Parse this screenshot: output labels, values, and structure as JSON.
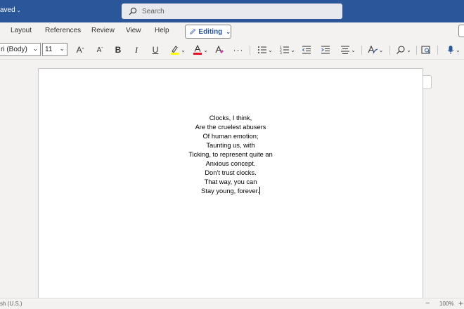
{
  "titlebar": {
    "doc_status": "aved",
    "search_placeholder": "Search"
  },
  "ribbon_tabs": [
    "Layout",
    "References",
    "Review",
    "View",
    "Help"
  ],
  "editing_mode": "Editing",
  "toolbar": {
    "font_name": "ri (Body)",
    "font_size": "11",
    "grow_font": "A",
    "shrink_font": "A",
    "bold": "B",
    "italic": "I",
    "underline": "U",
    "more": "···",
    "colors": {
      "highlight": "#ffff00",
      "font_color": "#e81123",
      "accent": "#2b579a"
    },
    "icons": [
      "grow-font-icon",
      "shrink-font-icon",
      "highlight-icon",
      "font-color-icon",
      "clear-format-icon",
      "bullets-icon",
      "numbering-icon",
      "decrease-indent-icon",
      "increase-indent-icon",
      "align-icon",
      "styles-icon",
      "find-icon",
      "reuse-files-icon",
      "dictate-icon"
    ]
  },
  "document": {
    "poem_lines": [
      "Clocks, I think,",
      "Are the cruelest abusers",
      "Of human emotion;",
      "Taunting us, with",
      "Ticking, to represent quite an",
      "Anxious concept.",
      "Don’t trust clocks.",
      "That way, you can",
      "Stay young, forever."
    ]
  },
  "statusbar": {
    "language": "sh (U.S.)",
    "zoom_minus": "−",
    "zoom": "100%",
    "zoom_plus": "+"
  }
}
